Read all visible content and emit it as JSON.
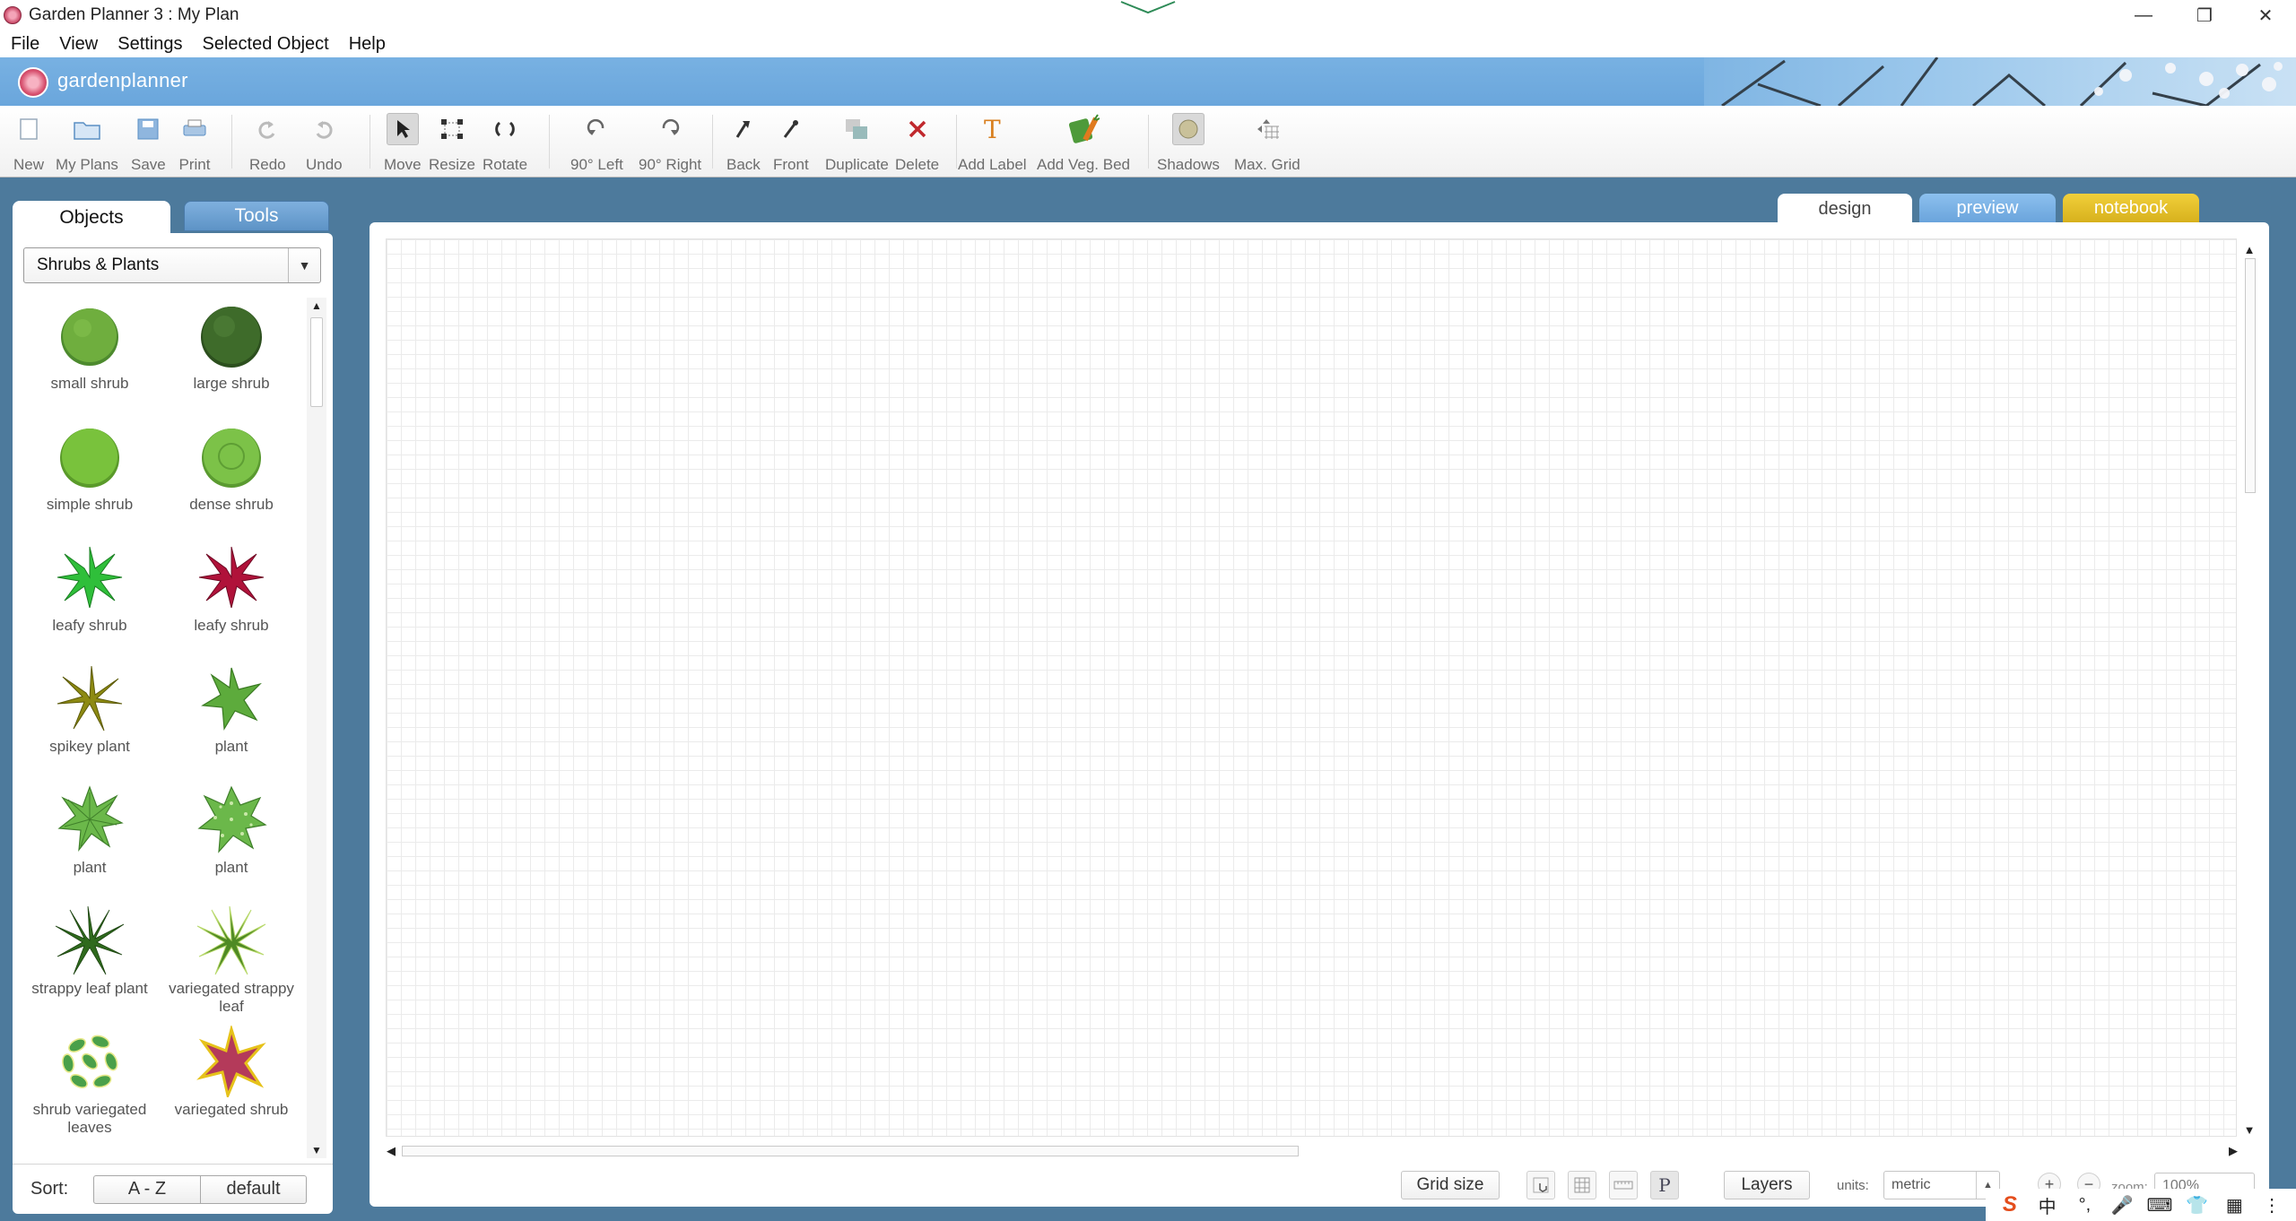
{
  "window": {
    "title": "Garden Planner 3 : My  Plan",
    "controls": [
      "minimize",
      "restore",
      "close"
    ]
  },
  "menu": [
    "File",
    "View",
    "Settings",
    "Selected Object",
    "Help"
  ],
  "brand": {
    "name": "gardenplanner"
  },
  "toolbar": {
    "new": "New",
    "my_plans": "My Plans",
    "save": "Save",
    "print": "Print",
    "redo": "Redo",
    "undo": "Undo",
    "move": "Move",
    "resize": "Resize",
    "rotate": "Rotate",
    "rot_left": "90° Left",
    "rot_right": "90° Right",
    "back": "Back",
    "front": "Front",
    "duplicate": "Duplicate",
    "delete": "Delete",
    "add_label": "Add Label",
    "add_veg_bed": "Add Veg. Bed",
    "shadows": "Shadows",
    "max_grid": "Max. Grid"
  },
  "left_panel": {
    "tabs": {
      "objects": "Objects",
      "tools": "Tools"
    },
    "category": "Shrubs & Plants",
    "items": [
      {
        "label": "small shrub",
        "icon": "small-shrub-icon",
        "color": "#6fae3e"
      },
      {
        "label": "large shrub",
        "icon": "large-shrub-icon",
        "color": "#3e6b2a"
      },
      {
        "label": "simple shrub",
        "icon": "simple-shrub-icon",
        "color": "#79c23c"
      },
      {
        "label": "dense shrub",
        "icon": "dense-shrub-icon",
        "color": "#7cc248"
      },
      {
        "label": "leafy shrub",
        "icon": "leafy-shrub-green-icon",
        "color": "#2fbf3a"
      },
      {
        "label": "leafy shrub",
        "icon": "leafy-shrub-red-icon",
        "color": "#b0123a"
      },
      {
        "label": "spikey plant",
        "icon": "spikey-plant-icon",
        "color": "#8d8a12"
      },
      {
        "label": "plant",
        "icon": "plant-star-icon",
        "color": "#5dab3c"
      },
      {
        "label": "plant",
        "icon": "plant-lobed-icon",
        "color": "#6bb84a"
      },
      {
        "label": "plant",
        "icon": "plant-spotted-icon",
        "color": "#6bb84a"
      },
      {
        "label": "strappy leaf plant",
        "icon": "strappy-leaf-plant-icon",
        "color": "#2f6a1d"
      },
      {
        "label": "variegated strappy leaf",
        "icon": "variegated-strappy-leaf-icon",
        "color": "#4f8a24"
      },
      {
        "label": "shrub variegated leaves",
        "icon": "shrub-variegated-leaves-icon",
        "color": "#4aa04a"
      },
      {
        "label": "variegated shrub",
        "icon": "variegated-shrub-icon",
        "color": "#b43a5a"
      }
    ],
    "sort": {
      "label": "Sort:",
      "az": "A - Z",
      "default": "default"
    }
  },
  "view_tabs": {
    "design": "design",
    "preview": "preview",
    "notebook": "notebook"
  },
  "bottom": {
    "grid_size": "Grid size",
    "layers": "Layers",
    "units_label": "units:",
    "units_value": "metric",
    "zoom_label": "zoom:",
    "zoom_value": "100%"
  },
  "tray": {
    "ime": "中"
  },
  "colors": {
    "brand_bar": "#6aa6dc",
    "background": "#4d7a9c",
    "preview_tab": "#6aa4dc",
    "notebook_tab": "#d7b11d",
    "delete_icon": "#c0282d"
  }
}
